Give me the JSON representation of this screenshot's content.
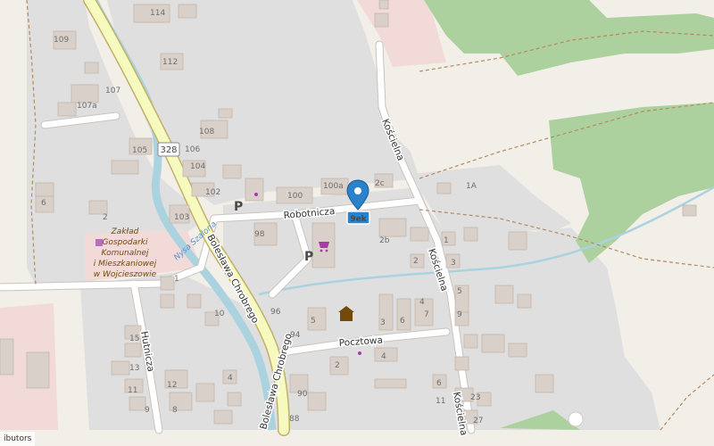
{
  "map": {
    "road_ref": "328",
    "marker_label": "9ek",
    "streets": {
      "robotnicza": "Robotnicza",
      "koscielna_top": "Kościelna",
      "koscielna_mid": "Kościelna",
      "koscielna_bottom": "Kościelna",
      "chrobrego_top": "Bolesława Chrobrego",
      "chrobrego_bottom": "Bolesława Chrobrego",
      "pocztowa": "Pocztowa",
      "hutnicza": "Hutnicza"
    },
    "river_name": "Nysa Szalona",
    "poi": {
      "line1": "Zakład",
      "line2": "Gospodarki",
      "line3": "Komunalnej",
      "line4": "i Mieszkaniowej",
      "line5": "w Wojcieszowie"
    },
    "parking_1": "P",
    "parking_2": "P",
    "house_numbers": {
      "n114": "114",
      "n109": "109",
      "n112": "112",
      "n107": "107",
      "n107a": "107a",
      "n108": "108",
      "n105": "105",
      "n106": "106",
      "n104": "104",
      "n102": "102",
      "n103": "103",
      "n100": "100",
      "n100a": "100a",
      "n2c": "2c",
      "n1A": "1A",
      "n6": "6",
      "n2": "2",
      "n98": "98",
      "n2b": "2b",
      "n1": "1",
      "n1b": "1",
      "n2d": "2",
      "n3": "3",
      "n5": "5",
      "n7": "7",
      "n4": "4",
      "n6b": "6",
      "n9": "9",
      "n96": "96",
      "n94": "94",
      "n3b": "3",
      "n5b": "5",
      "n10": "10",
      "n15": "15",
      "n13": "13",
      "n11": "11",
      "n9b": "9",
      "n8": "8",
      "n12": "12",
      "n4b": "4",
      "n2e": "2",
      "n90": "90",
      "n88": "88",
      "n4c": "4",
      "n6c": "6",
      "n23": "23",
      "n27": "27",
      "n11b": "11"
    }
  },
  "attribution": "ibutors",
  "colors": {
    "background": "#f2efe9",
    "residential": "#e0dfdf",
    "building": "#d9d0c9",
    "forest": "#add19e",
    "primary_road": "#f7fabf",
    "river": "#aad3df",
    "commercial": "#f2dad9",
    "marker": "#2a82cb"
  }
}
